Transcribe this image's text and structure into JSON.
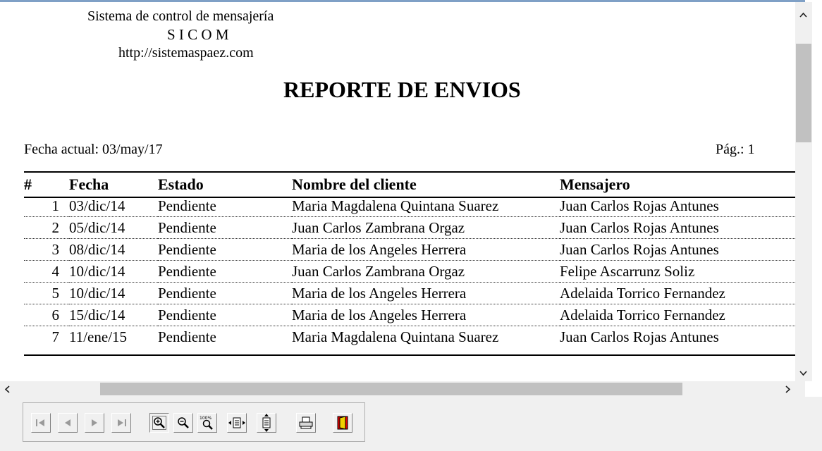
{
  "report": {
    "company_line": "Sistema de control de mensajería",
    "company_name": "S I C O M",
    "company_url": "http://sistemaspaez.com",
    "title": "REPORTE DE ENVIOS",
    "date_label": "Fecha actual:  03/may/17",
    "page_label": "Pág.: 1",
    "columns": [
      "#",
      "Fecha",
      "Estado",
      "Nombre del cliente",
      "Mensajero"
    ],
    "rows": [
      [
        "1",
        "03/dic/14",
        "Pendiente",
        "Maria Magdalena Quintana Suarez",
        "Juan Carlos Rojas Antunes"
      ],
      [
        "2",
        "05/dic/14",
        "Pendiente",
        "Juan Carlos Zambrana Orgaz",
        "Juan Carlos Rojas Antunes"
      ],
      [
        "3",
        "08/dic/14",
        "Pendiente",
        "Maria de los Angeles Herrera",
        "Juan Carlos Rojas Antunes"
      ],
      [
        "4",
        "10/dic/14",
        "Pendiente",
        "Juan Carlos Zambrana Orgaz",
        "Felipe Ascarrunz Soliz"
      ],
      [
        "5",
        "10/dic/14",
        "Pendiente",
        "Maria de los Angeles Herrera",
        "Adelaida Torrico Fernandez"
      ],
      [
        "6",
        "15/dic/14",
        "Pendiente",
        "Maria de los Angeles Herrera",
        "Adelaida Torrico Fernandez"
      ],
      [
        "7",
        "11/ene/15",
        "Pendiente",
        "Maria Magdalena Quintana Suarez",
        "Juan Carlos Rojas Antunes"
      ]
    ]
  },
  "toolbar": {
    "buttons": [
      "first-page-icon",
      "prev-page-icon",
      "next-page-icon",
      "last-page-icon",
      "zoom-in-icon",
      "zoom-out-icon",
      "zoom-100-icon",
      "page-width-icon",
      "whole-page-icon",
      "print-icon",
      "exit-icon"
    ],
    "zoom_100_text": "100%"
  },
  "colors": {
    "top_line": "#7fa0c6",
    "scroll_track": "#f0f0f0",
    "scroll_thumb": "#c1c1c1",
    "exit_red": "#e00000",
    "exit_yellow": "#f0d000"
  }
}
